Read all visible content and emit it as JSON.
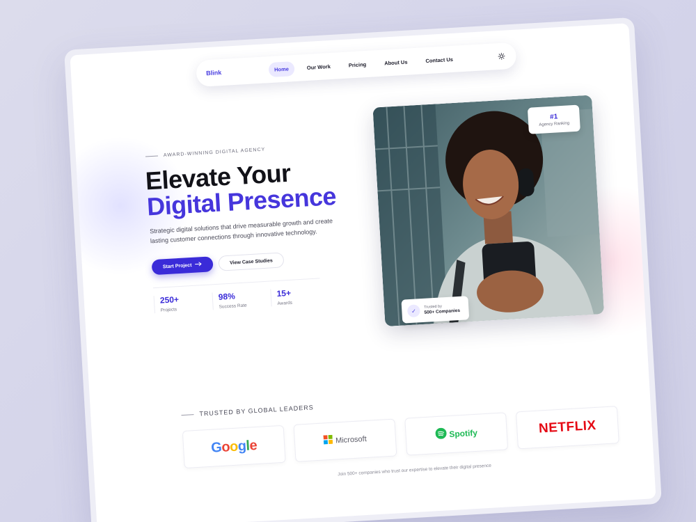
{
  "nav": {
    "brand": "Blink",
    "links": [
      "Home",
      "Our Work",
      "Pricing",
      "About Us",
      "Contact Us"
    ],
    "active": "Home",
    "theme_toggle_icon": "sun-icon"
  },
  "hero": {
    "eyebrow": "AWARD-WINNING DIGITAL AGENCY",
    "title_line1": "Elevate Your",
    "title_line2": "Digital Presence",
    "lead": "Strategic digital solutions that drive measurable growth and create lasting customer connections through innovative technology.",
    "primary_button": "Start Project",
    "primary_button_icon": "arrow-right-icon",
    "secondary_button": "View Case Studies",
    "stats": [
      {
        "value": "250+",
        "label": "Projects"
      },
      {
        "value": "98%",
        "label": "Success Rate"
      },
      {
        "value": "15+",
        "label": "Awards"
      }
    ]
  },
  "photo": {
    "rank_value": "#1",
    "rank_label": "Agency Ranking",
    "trust_line1": "Trusted by",
    "trust_line2": "500+ Companies",
    "trust_icon": "check-icon"
  },
  "trusted": {
    "heading": "TRUSTED BY GLOBAL LEADERS",
    "logos": [
      "Google",
      "Microsoft",
      "Spotify",
      "NETFLIX"
    ],
    "footnote": "Join 500+ companies who trust our expertise to elevate their digital presence"
  },
  "colors": {
    "accent": "#4636dc",
    "page_bg": "#d8d8ea",
    "spotify": "#1db954",
    "netflix": "#e50914"
  }
}
